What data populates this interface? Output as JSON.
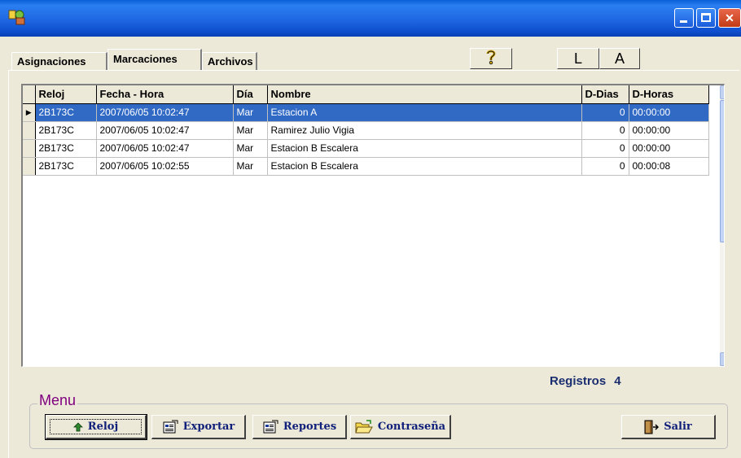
{
  "window": {
    "title": ""
  },
  "tabs": [
    {
      "label": "Asignaciones"
    },
    {
      "label": "Marcaciones"
    },
    {
      "label": "Archivos"
    }
  ],
  "toolbar": {
    "l_label": "L",
    "a_label": "A"
  },
  "grid": {
    "columns": [
      "Reloj",
      "Fecha - Hora",
      "Día",
      "Nombre",
      "D-Dias",
      "D-Horas"
    ],
    "rows": [
      {
        "reloj": "2B173C",
        "fecha": "2007/06/05 10:02:47",
        "dia": "Mar",
        "nombre": "Estacion A",
        "ddias": "0",
        "dhoras": "00:00:00"
      },
      {
        "reloj": "2B173C",
        "fecha": "2007/06/05 10:02:47",
        "dia": "Mar",
        "nombre": "Ramirez Julio Vigia",
        "ddias": "0",
        "dhoras": "00:00:00"
      },
      {
        "reloj": "2B173C",
        "fecha": "2007/06/05 10:02:47",
        "dia": "Mar",
        "nombre": "Estacion B Escalera",
        "ddias": "0",
        "dhoras": "00:00:00"
      },
      {
        "reloj": "2B173C",
        "fecha": "2007/06/05 10:02:55",
        "dia": "Mar",
        "nombre": "Estacion B Escalera",
        "ddias": "0",
        "dhoras": "00:00:08"
      }
    ],
    "selected_row": 0
  },
  "status": {
    "registros_label": "Registros",
    "registros_count": "4"
  },
  "menu": {
    "legend": "Menu",
    "reloj_label": "Reloj",
    "exportar_label": "Exportar",
    "reportes_label": "Reportes",
    "contrasena_label": "Contraseña",
    "salir_label": "Salir"
  },
  "colors": {
    "titlebar": "#0a5fd8",
    "selection": "#316ac5",
    "menu_legend": "#800080",
    "button_text": "#10207a"
  }
}
